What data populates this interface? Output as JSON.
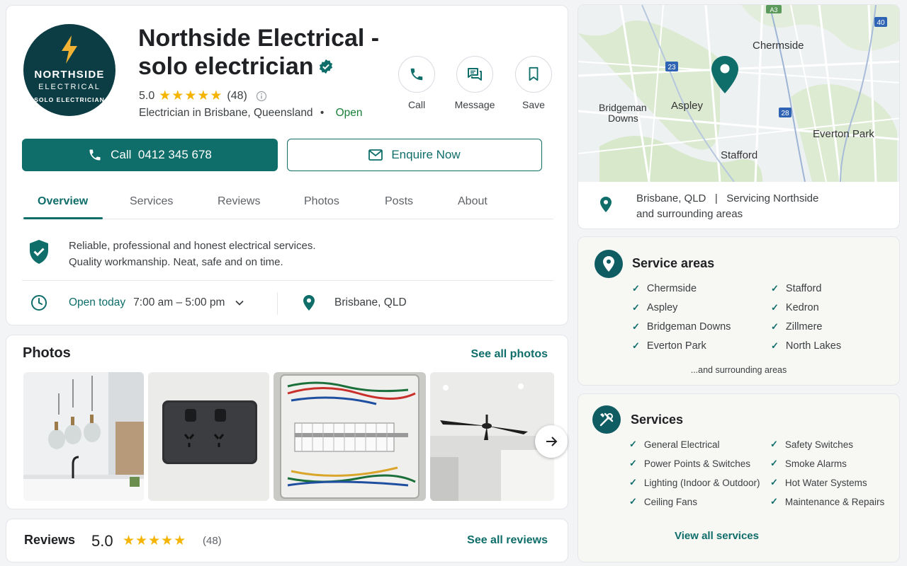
{
  "business": {
    "logo_line1": "NORTHSIDE",
    "logo_line2": "ELECTRICAL",
    "logo_line3": "SOLO ELECTRICIAN",
    "name": "Northside Electrical - solo electrician",
    "rating": "5.0",
    "stars": "★★★★★",
    "review_count": "(48)",
    "category": "Electrician in Brisbane, Queensland",
    "bullet": "•",
    "status": "Open"
  },
  "actions": {
    "call": "Call",
    "message": "Message",
    "save": "Save"
  },
  "cta": {
    "call_label": "Call",
    "phone": "0412 345 678",
    "enquire": "Enquire Now"
  },
  "tabs": [
    {
      "label": "Overview"
    },
    {
      "label": "Services"
    },
    {
      "label": "Reviews"
    },
    {
      "label": "Photos"
    },
    {
      "label": "Posts"
    },
    {
      "label": "About"
    }
  ],
  "overview": {
    "desc_line1": "Reliable, professional and honest electrical services.",
    "desc_line2": "Quality workmanship. Neat, safe and on time.",
    "open_today": "Open today",
    "hours": "7:00 am – 5:00 pm",
    "location": "Brisbane, QLD"
  },
  "photos": {
    "title": "Photos",
    "see_all": "See all photos"
  },
  "reviews": {
    "title": "Reviews",
    "score": "5.0",
    "stars": "★★★★★",
    "count": "(48)",
    "see_all": "See all reviews"
  },
  "map": {
    "labels": {
      "chermside": "Chermside",
      "aspley": "Aspley",
      "bridgeman1": "Bridgeman",
      "bridgeman2": "Downs",
      "everton": "Everton Park",
      "stafford": "Stafford",
      "r23": "23",
      "r28": "28",
      "r40": "40",
      "a3": "A3"
    },
    "info_line1": "Brisbane, QLD   |   Servicing Northside",
    "info_line2": "and surrounding areas"
  },
  "service_areas": {
    "title": "Service areas",
    "col1": [
      "Chermside",
      "Aspley",
      "Bridgeman Downs",
      "Everton Park"
    ],
    "col2": [
      "Stafford",
      "Kedron",
      "Zillmere",
      "North Lakes"
    ],
    "more": "...and surrounding areas"
  },
  "services": {
    "title": "Services",
    "col1": [
      "General Electrical",
      "Power Points & Switches",
      "Lighting (Indoor & Outdoor)",
      "Ceiling Fans"
    ],
    "col2": [
      "Safety Switches",
      "Smoke Alarms",
      "Hot Water Systems",
      "Maintenance & Repairs"
    ],
    "view_all": "View all services"
  },
  "colors": {
    "accent": "#0f6e6a",
    "open": "#188038",
    "star": "#f4b400",
    "logo_bg": "#0d3d44"
  }
}
